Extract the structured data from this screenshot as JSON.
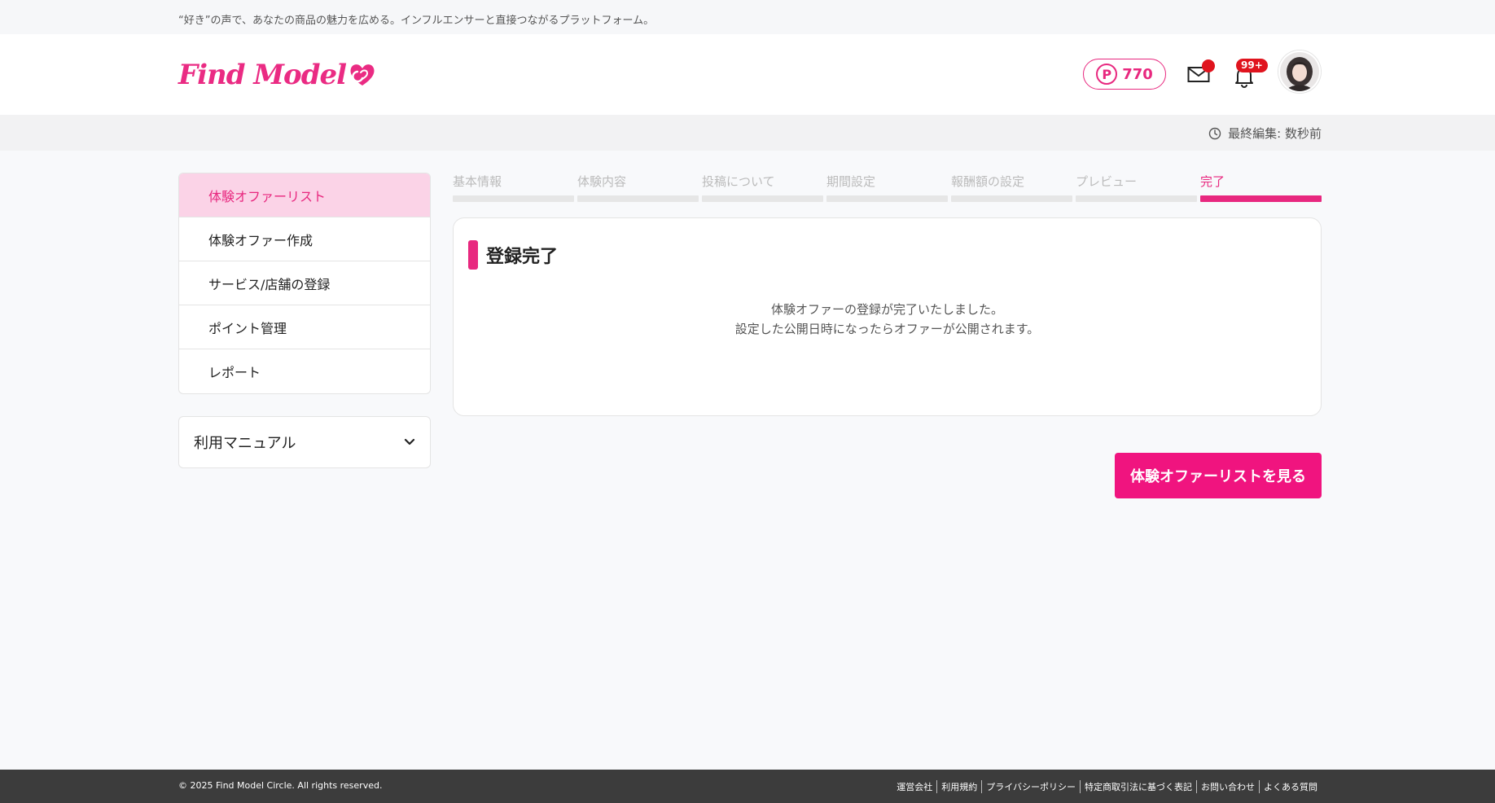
{
  "tagline": "“好き”の声で、あなたの商品の魅力を広める。インフルエンサーと直接つながるプラットフォーム。",
  "header": {
    "logo_text": "Find Model",
    "points": {
      "prefix": "P",
      "value": "770"
    },
    "notification_badge": "99+",
    "icons": {
      "mail": "mail-icon",
      "bell": "bell-icon",
      "avatar": "avatar-image"
    }
  },
  "edit_status": {
    "text": "最終編集: 数秒前",
    "icon": "clock-icon"
  },
  "sidebar": {
    "items": [
      {
        "label": "体験オファーリスト",
        "active": true
      },
      {
        "label": "体験オファー作成",
        "active": false
      },
      {
        "label": "サービス/店舗の登録",
        "active": false
      },
      {
        "label": "ポイント管理",
        "active": false
      },
      {
        "label": "レポート",
        "active": false
      }
    ]
  },
  "manual": {
    "label": "利用マニュアル",
    "icon": "chevron-down-icon"
  },
  "steps": [
    {
      "label": "基本情報"
    },
    {
      "label": "体験内容"
    },
    {
      "label": "投稿について"
    },
    {
      "label": "期間設定"
    },
    {
      "label": "報酬額の設定"
    },
    {
      "label": "プレビュー"
    },
    {
      "label": "完了",
      "current": true
    }
  ],
  "card": {
    "title": "登録完了",
    "line1": "体験オファーの登録が完了いたしました。",
    "line2": "設定した公開日時になったらオファーが公開されます。"
  },
  "cta_label": "体験オファーリストを見る",
  "footer": {
    "copyright": "© 2025 Find Model Circle. All rights reserved.",
    "links": [
      "運営会社",
      "利用規約",
      "プライバシーポリシー",
      "特定商取引法に基づく表記",
      "お問い合わせ",
      "よくある質問"
    ]
  },
  "colors": {
    "accent": "#e8287f",
    "active_bg": "#fbd3e7",
    "badge": "#e0141e",
    "footer_bg": "#3c3c3c"
  }
}
